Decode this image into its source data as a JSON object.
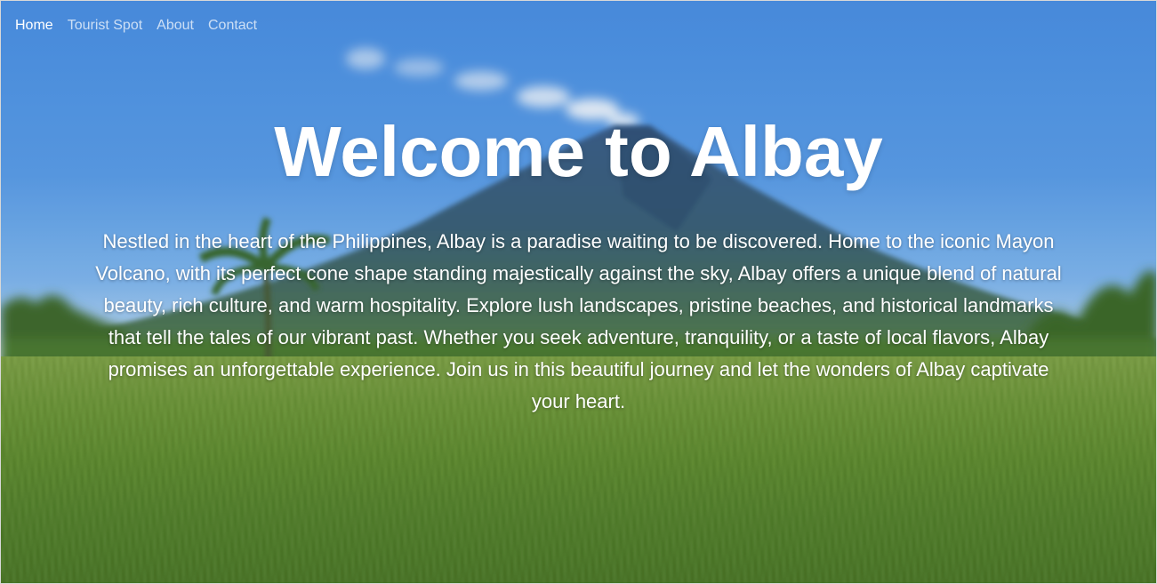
{
  "nav": {
    "items": [
      {
        "label": "Home",
        "active": true
      },
      {
        "label": "Tourist Spot",
        "active": false
      },
      {
        "label": "About",
        "active": false
      },
      {
        "label": "Contact",
        "active": false
      }
    ]
  },
  "hero": {
    "title": "Welcome to Albay",
    "description": "Nestled in the heart of the Philippines, Albay is a paradise waiting to be discovered. Home to the iconic Mayon Volcano, with its perfect cone shape standing majestically against the sky, Albay offers a unique blend of natural beauty, rich culture, and warm hospitality. Explore lush landscapes, pristine beaches, and historical landmarks that tell the tales of our vibrant past. Whether you seek adventure, tranquility, or a taste of local flavors, Albay promises an unforgettable experience. Join us in this beautiful journey and let the wonders of Albay captivate your heart."
  },
  "background": {
    "image": "mayon-volcano-landscape",
    "colors": {
      "sky": "#4a8fe3",
      "mountain": "#2f4f78",
      "field": "#5f8f2d",
      "text": "#ffffff"
    }
  }
}
